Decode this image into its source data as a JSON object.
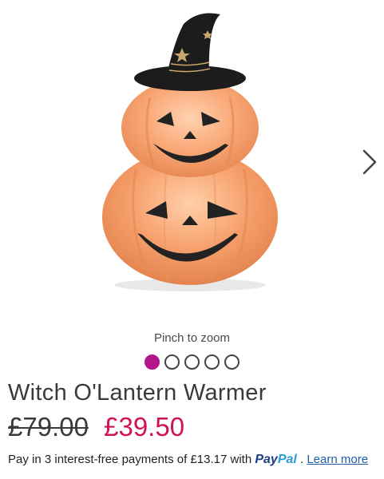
{
  "product": {
    "image_alt": "Stacked jack-o'-lantern pumpkins wearing a witch hat",
    "title": "Witch O'Lantern Warmer",
    "old_price": "£79.00",
    "new_price": "£39.50"
  },
  "gallery": {
    "pinch_hint": "Pinch to zoom",
    "next_icon": "chevron-right-icon",
    "dots": [
      {
        "active": true
      },
      {
        "active": false
      },
      {
        "active": false
      },
      {
        "active": false
      },
      {
        "active": false
      }
    ]
  },
  "payment": {
    "text_before": "Pay in 3 interest-free payments of £13.17 with",
    "paypal_pay": "Pay",
    "paypal_pal": "Pal",
    "separator": ".",
    "learn_more": "Learn more"
  },
  "colors": {
    "accent_dot": "#b3168b",
    "sale_price": "#d1134f",
    "paypal_dark": "#1b3c8a",
    "paypal_light": "#2a9bd7",
    "link": "#1f5fa8"
  }
}
